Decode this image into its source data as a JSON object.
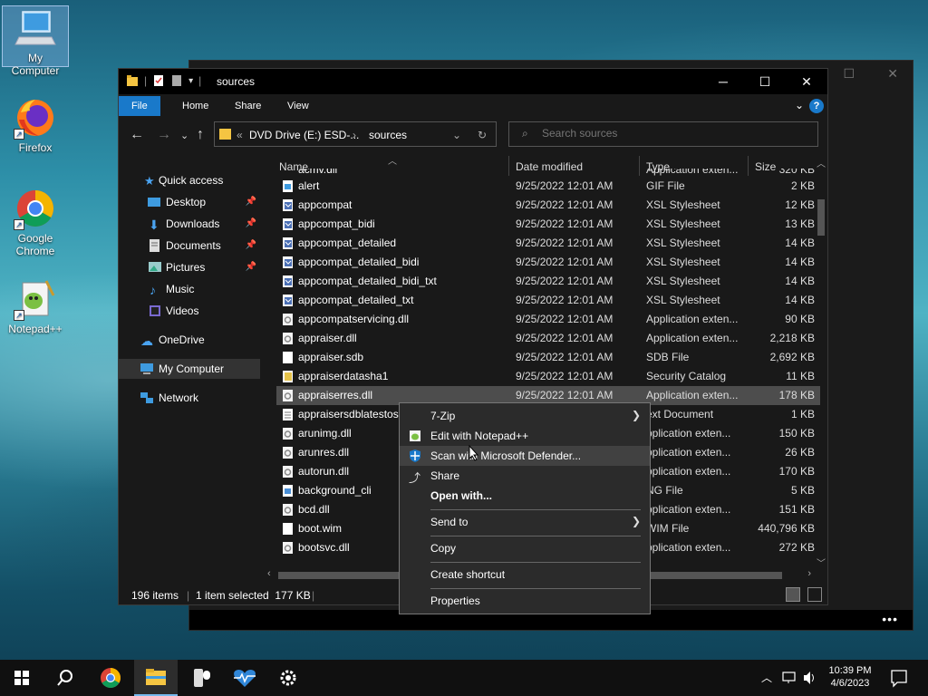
{
  "desktop": {
    "icons": [
      {
        "label": "My Computer"
      },
      {
        "label": "Firefox"
      },
      {
        "label": "Google Chrome"
      },
      {
        "label": "Notepad++"
      }
    ]
  },
  "explorer": {
    "title": "sources",
    "tabs": [
      "File",
      "Home",
      "Share",
      "View"
    ],
    "address": {
      "drive": "DVD Drive (E:) ESD-...",
      "folder": "sources",
      "overflow": "«"
    },
    "search_placeholder": "Search sources",
    "nav": {
      "quick_access": "Quick access",
      "items": [
        "Desktop",
        "Downloads",
        "Documents",
        "Pictures",
        "Music",
        "Videos"
      ],
      "onedrive": "OneDrive",
      "my_computer": "My Computer",
      "network": "Network"
    },
    "columns": {
      "name": "Name",
      "date": "Date modified",
      "type": "Type",
      "size": "Size"
    },
    "partial_top": {
      "name": "acmv.dll",
      "type": "Application exten...",
      "size": "320 KB"
    },
    "files": [
      {
        "name": "alert",
        "date": "9/25/2022 12:01 AM",
        "type": "GIF File",
        "size": "2 KB",
        "icon": "gif"
      },
      {
        "name": "appcompat",
        "date": "9/25/2022 12:01 AM",
        "type": "XSL Stylesheet",
        "size": "12 KB",
        "icon": "xsl"
      },
      {
        "name": "appcompat_bidi",
        "date": "9/25/2022 12:01 AM",
        "type": "XSL Stylesheet",
        "size": "13 KB",
        "icon": "xsl"
      },
      {
        "name": "appcompat_detailed",
        "date": "9/25/2022 12:01 AM",
        "type": "XSL Stylesheet",
        "size": "14 KB",
        "icon": "xsl"
      },
      {
        "name": "appcompat_detailed_bidi",
        "date": "9/25/2022 12:01 AM",
        "type": "XSL Stylesheet",
        "size": "14 KB",
        "icon": "xsl"
      },
      {
        "name": "appcompat_detailed_bidi_txt",
        "date": "9/25/2022 12:01 AM",
        "type": "XSL Stylesheet",
        "size": "14 KB",
        "icon": "xsl"
      },
      {
        "name": "appcompat_detailed_txt",
        "date": "9/25/2022 12:01 AM",
        "type": "XSL Stylesheet",
        "size": "14 KB",
        "icon": "xsl"
      },
      {
        "name": "appcompatservicing.dll",
        "date": "9/25/2022 12:01 AM",
        "type": "Application exten...",
        "size": "90 KB",
        "icon": "dll"
      },
      {
        "name": "appraiser.dll",
        "date": "9/25/2022 12:01 AM",
        "type": "Application exten...",
        "size": "2,218 KB",
        "icon": "dll"
      },
      {
        "name": "appraiser.sdb",
        "date": "9/25/2022 12:01 AM",
        "type": "SDB File",
        "size": "2,692 KB",
        "icon": "blank"
      },
      {
        "name": "appraiserdatasha1",
        "date": "9/25/2022 12:01 AM",
        "type": "Security Catalog",
        "size": "11 KB",
        "icon": "cat"
      },
      {
        "name": "appraiserres.dll",
        "date": "9/25/2022 12:01 AM",
        "type": "Application exten...",
        "size": "178 KB",
        "icon": "dll",
        "selected": true
      },
      {
        "name": "appraisersdblatestosh",
        "date": "",
        "type": "ext Document",
        "size": "1 KB",
        "icon": "txt"
      },
      {
        "name": "arunimg.dll",
        "date": "",
        "type": "pplication exten...",
        "size": "150 KB",
        "icon": "dll"
      },
      {
        "name": "arunres.dll",
        "date": "",
        "type": "pplication exten...",
        "size": "26 KB",
        "icon": "dll"
      },
      {
        "name": "autorun.dll",
        "date": "",
        "type": "pplication exten...",
        "size": "170 KB",
        "icon": "dll"
      },
      {
        "name": "background_cli",
        "date": "",
        "type": "NG File",
        "size": "5 KB",
        "icon": "png"
      },
      {
        "name": "bcd.dll",
        "date": "",
        "type": "pplication exten...",
        "size": "151 KB",
        "icon": "dll"
      },
      {
        "name": "boot.wim",
        "date": "",
        "type": "WIM File",
        "size": "440,796 KB",
        "icon": "blank"
      },
      {
        "name": "bootsvc.dll",
        "date": "",
        "type": "pplication exten...",
        "size": "272 KB",
        "icon": "dll"
      }
    ],
    "status": {
      "count": "196 items",
      "selected": "1 item selected  177 KB"
    }
  },
  "context_menu": {
    "items": [
      {
        "label": "7-Zip",
        "submenu": true,
        "icon": ""
      },
      {
        "label": "Edit with Notepad++",
        "submenu": false,
        "icon": "notepadpp-icon"
      },
      {
        "label": "Scan with Microsoft Defender...",
        "submenu": false,
        "icon": "defender-shield-icon"
      },
      {
        "label": "Share",
        "submenu": false,
        "icon": "share-icon"
      },
      {
        "label": "Open with...",
        "submenu": false,
        "icon": "",
        "bold": true
      },
      {
        "label": "Send to",
        "submenu": true,
        "icon": ""
      },
      {
        "label": "Copy",
        "submenu": false,
        "icon": ""
      },
      {
        "label": "Create shortcut",
        "submenu": false,
        "icon": ""
      },
      {
        "label": "Properties",
        "submenu": false,
        "icon": ""
      }
    ]
  },
  "taskbar": {
    "time": "10:39 PM",
    "date": "4/6/2023"
  },
  "colors": {
    "accent": "#1979ca",
    "taskbar": "#101010",
    "window": "#191919"
  }
}
